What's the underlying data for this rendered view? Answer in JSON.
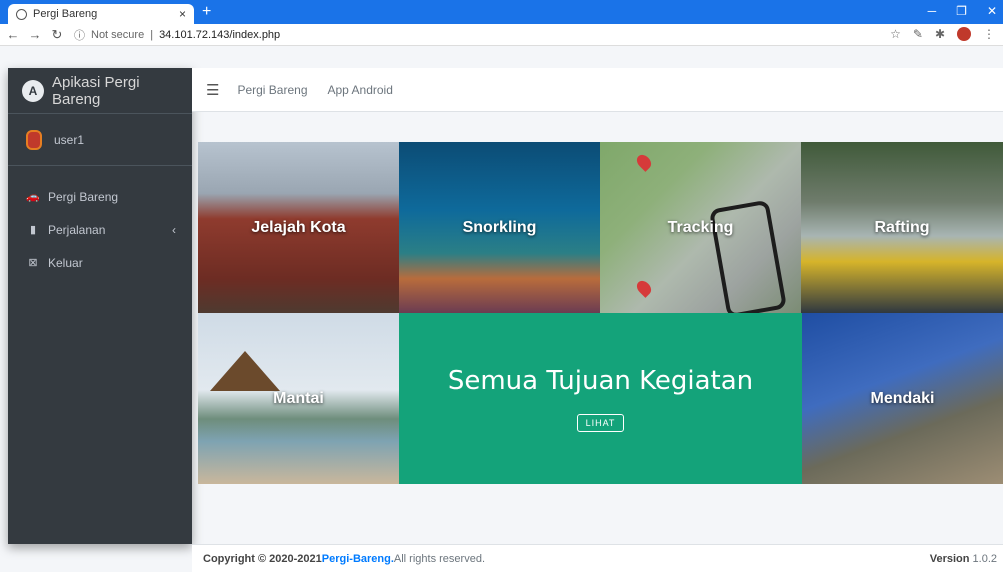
{
  "browser": {
    "tab_title": "Pergi Bareng",
    "tab_close": "×",
    "new_tab": "+",
    "security": "Not secure",
    "url": "34.101.72.143/index.php"
  },
  "sidebar": {
    "brand": "Apikasi Pergi Bareng",
    "brand_logo": "A",
    "user": "user1",
    "items": [
      {
        "label": "Pergi Bareng",
        "icon": "car-icon"
      },
      {
        "label": "Perjalanan",
        "icon": "copy-icon"
      },
      {
        "label": "Keluar",
        "icon": "close-square-icon"
      }
    ]
  },
  "navbar": {
    "links": [
      "Pergi Bareng",
      "App Android"
    ]
  },
  "tiles": {
    "kota": "Jelajah Kota",
    "snorkling": "Snorkling",
    "tracking": "Tracking",
    "rafting": "Rafting",
    "mantai": "Mantai",
    "mendaki": "Mendaki",
    "semua_title": "Semua Tujuan Kegiatan",
    "lihat": "LIHAT"
  },
  "footer": {
    "copyright": "Copyright © 2020-2021 ",
    "brand": "Pergi-Bareng.",
    "rights": " All rights reserved.",
    "version_label": "Version",
    "version_value": " 1.0.2"
  },
  "colors": {
    "accent": "#14a37a",
    "sidebar": "#343a40",
    "chrome": "#1a73e8",
    "link": "#007bff"
  }
}
